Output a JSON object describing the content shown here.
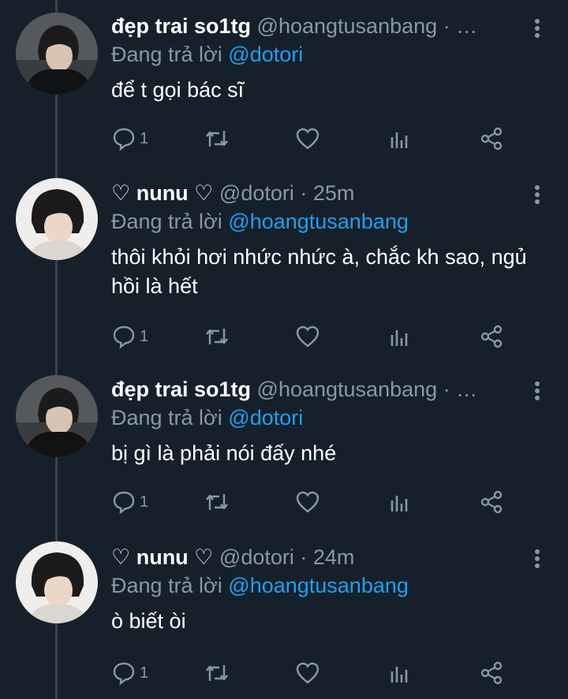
{
  "thread": {
    "tweets": [
      {
        "name": "đẹp trai so1tg",
        "handle": "@hoangtusanbang",
        "time": "· …",
        "reply_prefix": "Đang trả lời",
        "reply_to": "@dotori",
        "text": "để t gọi bác sĩ",
        "reply_count": "1"
      },
      {
        "name": "♡ nunu ♡",
        "handle": "@dotori",
        "time": "· 25m",
        "reply_prefix": "Đang trả lời",
        "reply_to": "@hoangtusanbang",
        "text": "thôi khỏi hơi nhức nhức à, chắc kh sao, ngủ hồi là hết",
        "reply_count": "1"
      },
      {
        "name": "đẹp trai so1tg",
        "handle": "@hoangtusanbang",
        "time": "· …",
        "reply_prefix": "Đang trả lời",
        "reply_to": "@dotori",
        "text": "bị gì là phải nói đấy nhé",
        "reply_count": "1"
      },
      {
        "name": "♡ nunu ♡",
        "handle": "@dotori",
        "time": "· 24m",
        "reply_prefix": "Đang trả lời",
        "reply_to": "@hoangtusanbang",
        "text": "ò biết òi",
        "reply_count": "1"
      }
    ]
  },
  "icons": {
    "more": "more-vertical-icon",
    "reply": "reply-bubble-icon",
    "retweet": "retweet-icon",
    "like": "heart-icon",
    "stats": "analytics-icon",
    "share": "share-icon"
  },
  "colors": {
    "background": "#15202b",
    "secondary_text": "#8899a6",
    "link": "#1da1f2",
    "thread_line": "#38444d"
  }
}
